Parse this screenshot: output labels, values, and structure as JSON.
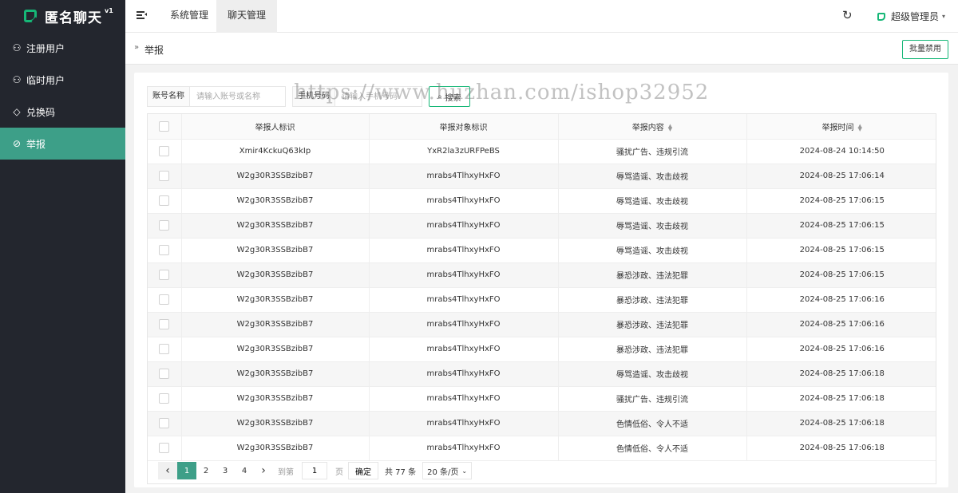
{
  "app": {
    "name": "匿名聊天",
    "version": "v1"
  },
  "sidebar": {
    "items": [
      {
        "label": "注册用户",
        "icon": "user-icon",
        "glyph": "⚇",
        "active": false
      },
      {
        "label": "临时用户",
        "icon": "user-temp-icon",
        "glyph": "⚇",
        "active": false
      },
      {
        "label": "兑换码",
        "icon": "diamond-icon",
        "glyph": "◇",
        "active": false
      },
      {
        "label": "举报",
        "icon": "ban-icon",
        "glyph": "⊘",
        "active": true
      }
    ]
  },
  "header": {
    "tabs": [
      {
        "label": "系统管理",
        "active": false
      },
      {
        "label": "聊天管理",
        "active": true
      }
    ],
    "refresh_glyph": "↻",
    "user_name": "超级管理员"
  },
  "breadcrumb": {
    "arrow": "»",
    "current": "举报"
  },
  "toolbar": {
    "batch_disable_label": "批量禁用"
  },
  "search": {
    "account_label": "账号名称",
    "account_placeholder": "请输入账号或名称",
    "phone_label": "手机号码",
    "phone_placeholder": "请输入手机号码",
    "search_button_label": "搜索"
  },
  "watermark": "https://www.huzhan.com/ishop32952",
  "table": {
    "columns": [
      {
        "label": "举报人标识",
        "sortable": false
      },
      {
        "label": "举报对象标识",
        "sortable": false
      },
      {
        "label": "举报内容",
        "sortable": true
      },
      {
        "label": "举报时间",
        "sortable": true
      }
    ],
    "rows": [
      [
        "Xmir4KckuQ63kIp",
        "YxR2la3zURFPeBS",
        "骚扰广告、违规引流",
        "2024-08-24 10:14:50"
      ],
      [
        "W2g30R3SSBzibB7",
        "mrabs4TlhxyHxFO",
        "辱骂造谣、攻击歧视",
        "2024-08-25 17:06:14"
      ],
      [
        "W2g30R3SSBzibB7",
        "mrabs4TlhxyHxFO",
        "辱骂造谣、攻击歧视",
        "2024-08-25 17:06:15"
      ],
      [
        "W2g30R3SSBzibB7",
        "mrabs4TlhxyHxFO",
        "辱骂造谣、攻击歧视",
        "2024-08-25 17:06:15"
      ],
      [
        "W2g30R3SSBzibB7",
        "mrabs4TlhxyHxFO",
        "辱骂造谣、攻击歧视",
        "2024-08-25 17:06:15"
      ],
      [
        "W2g30R3SSBzibB7",
        "mrabs4TlhxyHxFO",
        "暴恐涉政、违法犯罪",
        "2024-08-25 17:06:15"
      ],
      [
        "W2g30R3SSBzibB7",
        "mrabs4TlhxyHxFO",
        "暴恐涉政、违法犯罪",
        "2024-08-25 17:06:16"
      ],
      [
        "W2g30R3SSBzibB7",
        "mrabs4TlhxyHxFO",
        "暴恐涉政、违法犯罪",
        "2024-08-25 17:06:16"
      ],
      [
        "W2g30R3SSBzibB7",
        "mrabs4TlhxyHxFO",
        "暴恐涉政、违法犯罪",
        "2024-08-25 17:06:16"
      ],
      [
        "W2g30R3SSBzibB7",
        "mrabs4TlhxyHxFO",
        "辱骂造谣、攻击歧视",
        "2024-08-25 17:06:18"
      ],
      [
        "W2g30R3SSBzibB7",
        "mrabs4TlhxyHxFO",
        "骚扰广告、违规引流",
        "2024-08-25 17:06:18"
      ],
      [
        "W2g30R3SSBzibB7",
        "mrabs4TlhxyHxFO",
        "色情低俗、令人不适",
        "2024-08-25 17:06:18"
      ],
      [
        "W2g30R3SSBzibB7",
        "mrabs4TlhxyHxFO",
        "色情低俗、令人不适",
        "2024-08-25 17:06:18"
      ]
    ]
  },
  "pagination": {
    "pages": [
      "1",
      "2",
      "3",
      "4"
    ],
    "current_page": "1",
    "goto_prefix": "到第",
    "goto_value": "1",
    "goto_suffix": "页",
    "confirm_label": "确定",
    "total_text": "共 77 条",
    "page_size_text": "20 条/页"
  },
  "colors": {
    "sidebar_bg": "#23262e",
    "accent": "#3d9f88",
    "brand_green": "#16b777"
  }
}
